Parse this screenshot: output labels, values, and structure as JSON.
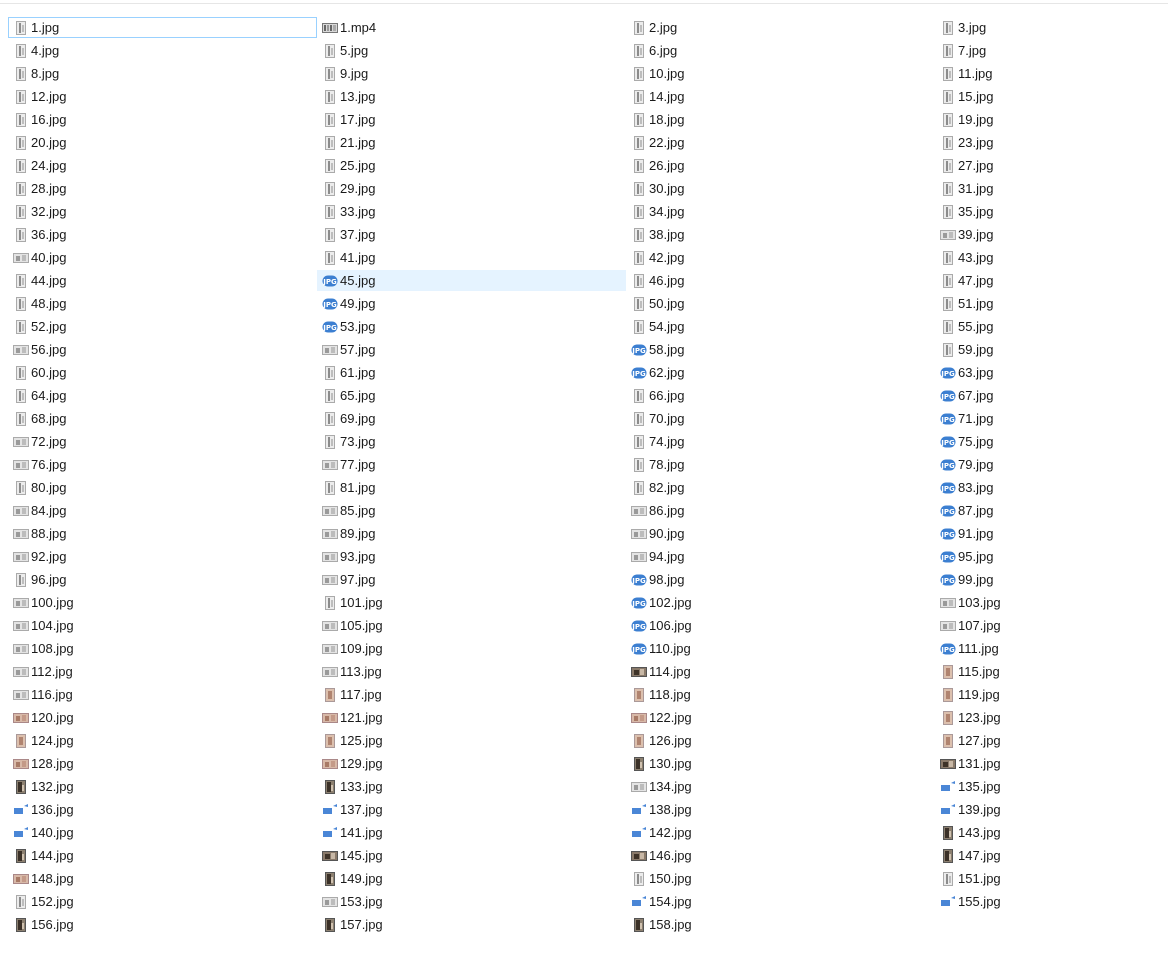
{
  "files": [
    {
      "name": "1.jpg",
      "icon": "thumb-portrait"
    },
    {
      "name": "1.mp4",
      "icon": "video"
    },
    {
      "name": "2.jpg",
      "icon": "thumb-portrait"
    },
    {
      "name": "3.jpg",
      "icon": "thumb-portrait"
    },
    {
      "name": "4.jpg",
      "icon": "thumb-portrait"
    },
    {
      "name": "5.jpg",
      "icon": "thumb-portrait"
    },
    {
      "name": "6.jpg",
      "icon": "thumb-portrait"
    },
    {
      "name": "7.jpg",
      "icon": "thumb-portrait"
    },
    {
      "name": "8.jpg",
      "icon": "thumb-portrait"
    },
    {
      "name": "9.jpg",
      "icon": "thumb-portrait"
    },
    {
      "name": "10.jpg",
      "icon": "thumb-portrait"
    },
    {
      "name": "11.jpg",
      "icon": "thumb-portrait"
    },
    {
      "name": "12.jpg",
      "icon": "thumb-portrait"
    },
    {
      "name": "13.jpg",
      "icon": "thumb-portrait"
    },
    {
      "name": "14.jpg",
      "icon": "thumb-portrait"
    },
    {
      "name": "15.jpg",
      "icon": "thumb-portrait"
    },
    {
      "name": "16.jpg",
      "icon": "thumb-portrait"
    },
    {
      "name": "17.jpg",
      "icon": "thumb-portrait"
    },
    {
      "name": "18.jpg",
      "icon": "thumb-portrait"
    },
    {
      "name": "19.jpg",
      "icon": "thumb-portrait"
    },
    {
      "name": "20.jpg",
      "icon": "thumb-portrait"
    },
    {
      "name": "21.jpg",
      "icon": "thumb-portrait"
    },
    {
      "name": "22.jpg",
      "icon": "thumb-portrait"
    },
    {
      "name": "23.jpg",
      "icon": "thumb-portrait"
    },
    {
      "name": "24.jpg",
      "icon": "thumb-portrait"
    },
    {
      "name": "25.jpg",
      "icon": "thumb-portrait"
    },
    {
      "name": "26.jpg",
      "icon": "thumb-portrait"
    },
    {
      "name": "27.jpg",
      "icon": "thumb-portrait"
    },
    {
      "name": "28.jpg",
      "icon": "thumb-portrait"
    },
    {
      "name": "29.jpg",
      "icon": "thumb-portrait"
    },
    {
      "name": "30.jpg",
      "icon": "thumb-portrait"
    },
    {
      "name": "31.jpg",
      "icon": "thumb-portrait"
    },
    {
      "name": "32.jpg",
      "icon": "thumb-portrait"
    },
    {
      "name": "33.jpg",
      "icon": "thumb-portrait"
    },
    {
      "name": "34.jpg",
      "icon": "thumb-portrait"
    },
    {
      "name": "35.jpg",
      "icon": "thumb-portrait"
    },
    {
      "name": "36.jpg",
      "icon": "thumb-portrait"
    },
    {
      "name": "37.jpg",
      "icon": "thumb-portrait"
    },
    {
      "name": "38.jpg",
      "icon": "thumb-portrait"
    },
    {
      "name": "39.jpg",
      "icon": "thumb-landscape"
    },
    {
      "name": "40.jpg",
      "icon": "thumb-landscape"
    },
    {
      "name": "41.jpg",
      "icon": "thumb-portrait"
    },
    {
      "name": "42.jpg",
      "icon": "thumb-portrait"
    },
    {
      "name": "43.jpg",
      "icon": "thumb-portrait"
    },
    {
      "name": "44.jpg",
      "icon": "thumb-portrait"
    },
    {
      "name": "45.jpg",
      "icon": "jpg"
    },
    {
      "name": "46.jpg",
      "icon": "thumb-portrait"
    },
    {
      "name": "47.jpg",
      "icon": "thumb-portrait"
    },
    {
      "name": "48.jpg",
      "icon": "thumb-portrait"
    },
    {
      "name": "49.jpg",
      "icon": "jpg"
    },
    {
      "name": "50.jpg",
      "icon": "thumb-portrait"
    },
    {
      "name": "51.jpg",
      "icon": "thumb-portrait"
    },
    {
      "name": "52.jpg",
      "icon": "thumb-portrait"
    },
    {
      "name": "53.jpg",
      "icon": "jpg"
    },
    {
      "name": "54.jpg",
      "icon": "thumb-portrait"
    },
    {
      "name": "55.jpg",
      "icon": "thumb-portrait"
    },
    {
      "name": "56.jpg",
      "icon": "thumb-landscape"
    },
    {
      "name": "57.jpg",
      "icon": "thumb-landscape"
    },
    {
      "name": "58.jpg",
      "icon": "jpg"
    },
    {
      "name": "59.jpg",
      "icon": "thumb-portrait"
    },
    {
      "name": "60.jpg",
      "icon": "thumb-portrait"
    },
    {
      "name": "61.jpg",
      "icon": "thumb-portrait"
    },
    {
      "name": "62.jpg",
      "icon": "jpg"
    },
    {
      "name": "63.jpg",
      "icon": "jpg"
    },
    {
      "name": "64.jpg",
      "icon": "thumb-portrait"
    },
    {
      "name": "65.jpg",
      "icon": "thumb-portrait"
    },
    {
      "name": "66.jpg",
      "icon": "thumb-portrait"
    },
    {
      "name": "67.jpg",
      "icon": "jpg"
    },
    {
      "name": "68.jpg",
      "icon": "thumb-portrait"
    },
    {
      "name": "69.jpg",
      "icon": "thumb-portrait"
    },
    {
      "name": "70.jpg",
      "icon": "thumb-portrait"
    },
    {
      "name": "71.jpg",
      "icon": "jpg"
    },
    {
      "name": "72.jpg",
      "icon": "thumb-landscape"
    },
    {
      "name": "73.jpg",
      "icon": "thumb-portrait"
    },
    {
      "name": "74.jpg",
      "icon": "thumb-portrait"
    },
    {
      "name": "75.jpg",
      "icon": "jpg"
    },
    {
      "name": "76.jpg",
      "icon": "thumb-landscape"
    },
    {
      "name": "77.jpg",
      "icon": "thumb-landscape"
    },
    {
      "name": "78.jpg",
      "icon": "thumb-portrait"
    },
    {
      "name": "79.jpg",
      "icon": "jpg"
    },
    {
      "name": "80.jpg",
      "icon": "thumb-portrait"
    },
    {
      "name": "81.jpg",
      "icon": "thumb-portrait"
    },
    {
      "name": "82.jpg",
      "icon": "thumb-portrait"
    },
    {
      "name": "83.jpg",
      "icon": "jpg"
    },
    {
      "name": "84.jpg",
      "icon": "thumb-landscape"
    },
    {
      "name": "85.jpg",
      "icon": "thumb-landscape"
    },
    {
      "name": "86.jpg",
      "icon": "thumb-landscape"
    },
    {
      "name": "87.jpg",
      "icon": "jpg"
    },
    {
      "name": "88.jpg",
      "icon": "thumb-landscape"
    },
    {
      "name": "89.jpg",
      "icon": "thumb-landscape"
    },
    {
      "name": "90.jpg",
      "icon": "thumb-landscape"
    },
    {
      "name": "91.jpg",
      "icon": "jpg"
    },
    {
      "name": "92.jpg",
      "icon": "thumb-landscape"
    },
    {
      "name": "93.jpg",
      "icon": "thumb-landscape"
    },
    {
      "name": "94.jpg",
      "icon": "thumb-landscape"
    },
    {
      "name": "95.jpg",
      "icon": "jpg"
    },
    {
      "name": "96.jpg",
      "icon": "thumb-portrait"
    },
    {
      "name": "97.jpg",
      "icon": "thumb-landscape"
    },
    {
      "name": "98.jpg",
      "icon": "jpg"
    },
    {
      "name": "99.jpg",
      "icon": "jpg"
    },
    {
      "name": "100.jpg",
      "icon": "thumb-landscape"
    },
    {
      "name": "101.jpg",
      "icon": "thumb-portrait"
    },
    {
      "name": "102.jpg",
      "icon": "jpg"
    },
    {
      "name": "103.jpg",
      "icon": "thumb-landscape"
    },
    {
      "name": "104.jpg",
      "icon": "thumb-landscape"
    },
    {
      "name": "105.jpg",
      "icon": "thumb-landscape"
    },
    {
      "name": "106.jpg",
      "icon": "jpg"
    },
    {
      "name": "107.jpg",
      "icon": "thumb-landscape"
    },
    {
      "name": "108.jpg",
      "icon": "thumb-landscape"
    },
    {
      "name": "109.jpg",
      "icon": "thumb-landscape"
    },
    {
      "name": "110.jpg",
      "icon": "jpg"
    },
    {
      "name": "111.jpg",
      "icon": "jpg"
    },
    {
      "name": "112.jpg",
      "icon": "thumb-landscape"
    },
    {
      "name": "113.jpg",
      "icon": "thumb-landscape"
    },
    {
      "name": "114.jpg",
      "icon": "thumb-landscape-dark"
    },
    {
      "name": "115.jpg",
      "icon": "thumb-portrait-warm"
    },
    {
      "name": "116.jpg",
      "icon": "thumb-landscape"
    },
    {
      "name": "117.jpg",
      "icon": "thumb-portrait-warm"
    },
    {
      "name": "118.jpg",
      "icon": "thumb-portrait-warm"
    },
    {
      "name": "119.jpg",
      "icon": "thumb-portrait-warm"
    },
    {
      "name": "120.jpg",
      "icon": "thumb-landscape-warm"
    },
    {
      "name": "121.jpg",
      "icon": "thumb-landscape-warm"
    },
    {
      "name": "122.jpg",
      "icon": "thumb-landscape-warm"
    },
    {
      "name": "123.jpg",
      "icon": "thumb-portrait-warm"
    },
    {
      "name": "124.jpg",
      "icon": "thumb-portrait-warm"
    },
    {
      "name": "125.jpg",
      "icon": "thumb-portrait-warm"
    },
    {
      "name": "126.jpg",
      "icon": "thumb-portrait-warm"
    },
    {
      "name": "127.jpg",
      "icon": "thumb-portrait-warm"
    },
    {
      "name": "128.jpg",
      "icon": "thumb-landscape-warm"
    },
    {
      "name": "129.jpg",
      "icon": "thumb-landscape-warm"
    },
    {
      "name": "130.jpg",
      "icon": "thumb-portrait-dark"
    },
    {
      "name": "131.jpg",
      "icon": "thumb-landscape-dark"
    },
    {
      "name": "132.jpg",
      "icon": "thumb-portrait-dark"
    },
    {
      "name": "133.jpg",
      "icon": "thumb-portrait-dark"
    },
    {
      "name": "134.jpg",
      "icon": "thumb-landscape"
    },
    {
      "name": "135.jpg",
      "icon": "blue-generic"
    },
    {
      "name": "136.jpg",
      "icon": "blue-generic"
    },
    {
      "name": "137.jpg",
      "icon": "blue-generic"
    },
    {
      "name": "138.jpg",
      "icon": "blue-generic"
    },
    {
      "name": "139.jpg",
      "icon": "blue-generic"
    },
    {
      "name": "140.jpg",
      "icon": "blue-generic"
    },
    {
      "name": "141.jpg",
      "icon": "blue-generic"
    },
    {
      "name": "142.jpg",
      "icon": "blue-generic"
    },
    {
      "name": "143.jpg",
      "icon": "thumb-portrait-dark"
    },
    {
      "name": "144.jpg",
      "icon": "thumb-portrait-dark"
    },
    {
      "name": "145.jpg",
      "icon": "thumb-landscape-dark"
    },
    {
      "name": "146.jpg",
      "icon": "thumb-landscape-dark"
    },
    {
      "name": "147.jpg",
      "icon": "thumb-portrait-dark"
    },
    {
      "name": "148.jpg",
      "icon": "thumb-landscape-warm"
    },
    {
      "name": "149.jpg",
      "icon": "thumb-portrait-dark"
    },
    {
      "name": "150.jpg",
      "icon": "thumb-portrait"
    },
    {
      "name": "151.jpg",
      "icon": "thumb-portrait"
    },
    {
      "name": "152.jpg",
      "icon": "thumb-portrait"
    },
    {
      "name": "153.jpg",
      "icon": "thumb-landscape"
    },
    {
      "name": "154.jpg",
      "icon": "blue-generic"
    },
    {
      "name": "155.jpg",
      "icon": "blue-generic"
    },
    {
      "name": "156.jpg",
      "icon": "thumb-portrait-dark"
    },
    {
      "name": "157.jpg",
      "icon": "thumb-portrait-dark"
    },
    {
      "name": "158.jpg",
      "icon": "thumb-portrait-dark"
    }
  ],
  "state": {
    "focused_index": 0,
    "hovered_index": 45
  },
  "colors": {
    "focus_border": "#99d1ff",
    "hover_bg": "#e5f3ff",
    "jpg_badge": "#3c7fd1",
    "text": "#1a1a1a"
  }
}
